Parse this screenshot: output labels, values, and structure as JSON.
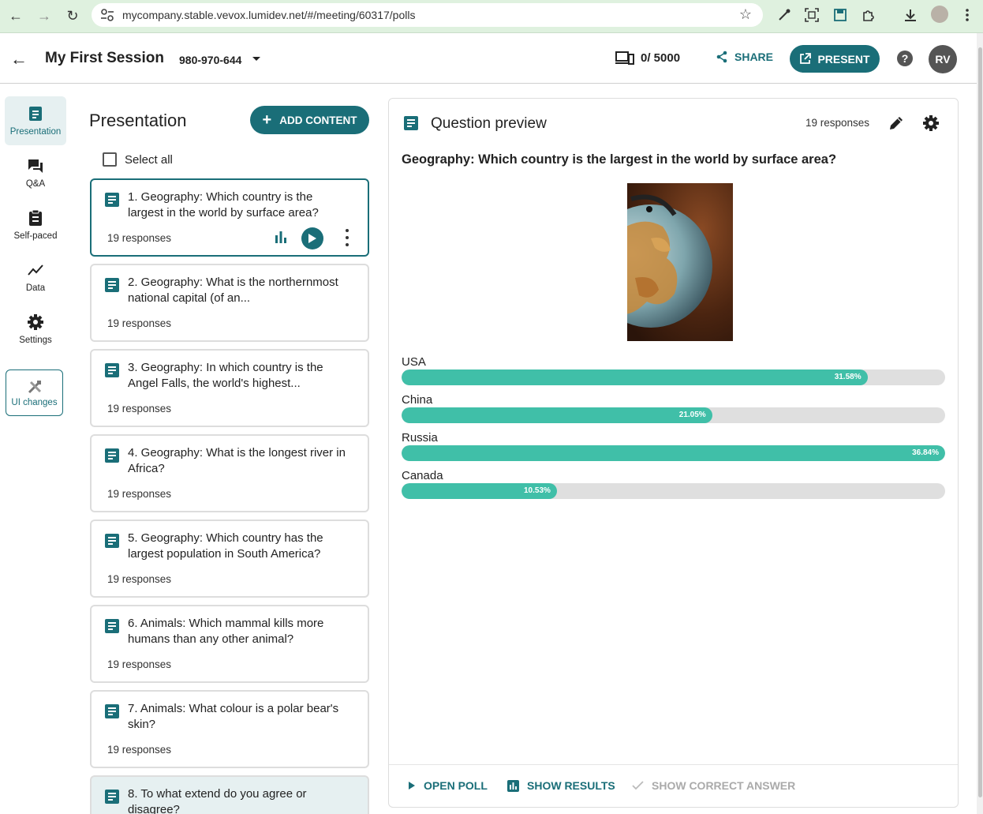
{
  "browser": {
    "url": "mycompany.stable.vevox.lumidev.net/#/meeting/60317/polls"
  },
  "header": {
    "title": "My First Session",
    "session_code": "980-970-644",
    "participants": "0/ 5000",
    "share_label": "SHARE",
    "present_label": "PRESENT",
    "user_initials": "RV"
  },
  "nav": {
    "items": [
      {
        "label": "Presentation",
        "icon": "presentation-icon",
        "active": true
      },
      {
        "label": "Q&A",
        "icon": "chat-icon"
      },
      {
        "label": "Self-paced",
        "icon": "clipboard-icon"
      },
      {
        "label": "Data",
        "icon": "trend-icon"
      },
      {
        "label": "Settings",
        "icon": "gear-icon"
      }
    ],
    "ui_changes": "UI changes"
  },
  "presentation": {
    "title": "Presentation",
    "add_label": "ADD CONTENT",
    "select_all": "Select all",
    "cards": [
      {
        "text": "1. Geography: Which country is the largest in the world by surface area?",
        "responses": "19 responses"
      },
      {
        "text": "2. Geography: What is the northernmost national capital (of an...",
        "responses": "19 responses"
      },
      {
        "text": "3. Geography: In which country is the Angel Falls, the world's highest...",
        "responses": "19 responses"
      },
      {
        "text": "4. Geography: What is the longest river in Africa?",
        "responses": "19 responses"
      },
      {
        "text": "5. Geography: Which country has the largest population in South America?",
        "responses": "19 responses"
      },
      {
        "text": "6. Animals: Which mammal kills more humans than any other animal?",
        "responses": "19 responses"
      },
      {
        "text": "7. Animals: What colour is a polar bear's skin?",
        "responses": "19 responses"
      },
      {
        "text": "8. To what extend do you agree or disagree?",
        "responses": ""
      }
    ]
  },
  "preview": {
    "title": "Question preview",
    "responses": "19 responses",
    "question": "Geography: Which country is the largest in the world by surface area?",
    "options": [
      {
        "label": "USA",
        "percent": 31.58,
        "percent_label": "31.58%"
      },
      {
        "label": "China",
        "percent": 21.05,
        "percent_label": "21.05%"
      },
      {
        "label": "Russia",
        "percent": 36.84,
        "percent_label": "36.84%"
      },
      {
        "label": "Canada",
        "percent": 10.53,
        "percent_label": "10.53%"
      }
    ],
    "footer": {
      "open_poll": "OPEN POLL",
      "show_results": "SHOW RESULTS",
      "show_correct": "SHOW CORRECT ANSWER"
    }
  },
  "colors": {
    "accent": "#1a6e78",
    "bar": "#40bfa8",
    "track": "#dfdfdf"
  }
}
